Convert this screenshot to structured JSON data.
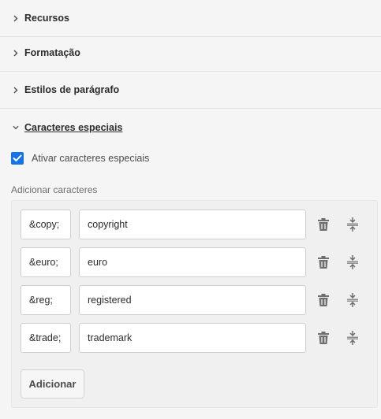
{
  "sections": [
    {
      "label": "Recursos",
      "expanded": false
    },
    {
      "label": "Formatação",
      "expanded": false
    },
    {
      "label": "Estilos de parágrafo",
      "expanded": false
    },
    {
      "label": "Caracteres especiais",
      "expanded": true
    }
  ],
  "special_chars": {
    "checkbox_label": "Ativar caracteres especiais",
    "checkbox_checked": true,
    "add_label": "Adicionar caracteres",
    "rows": [
      {
        "code": "&copy;",
        "name": "copyright"
      },
      {
        "code": "&euro;",
        "name": "euro"
      },
      {
        "code": "&reg;",
        "name": "registered"
      },
      {
        "code": "&trade;",
        "name": "trademark"
      }
    ],
    "add_button": "Adicionar"
  },
  "colors": {
    "accent": "#1473e6",
    "background": "#f5f5f5"
  },
  "icons": {
    "collapsed": "chevron-right-icon",
    "expanded": "chevron-down-icon",
    "delete": "trash-icon",
    "reorder": "drag-handle-icon",
    "check": "checkmark-icon"
  }
}
